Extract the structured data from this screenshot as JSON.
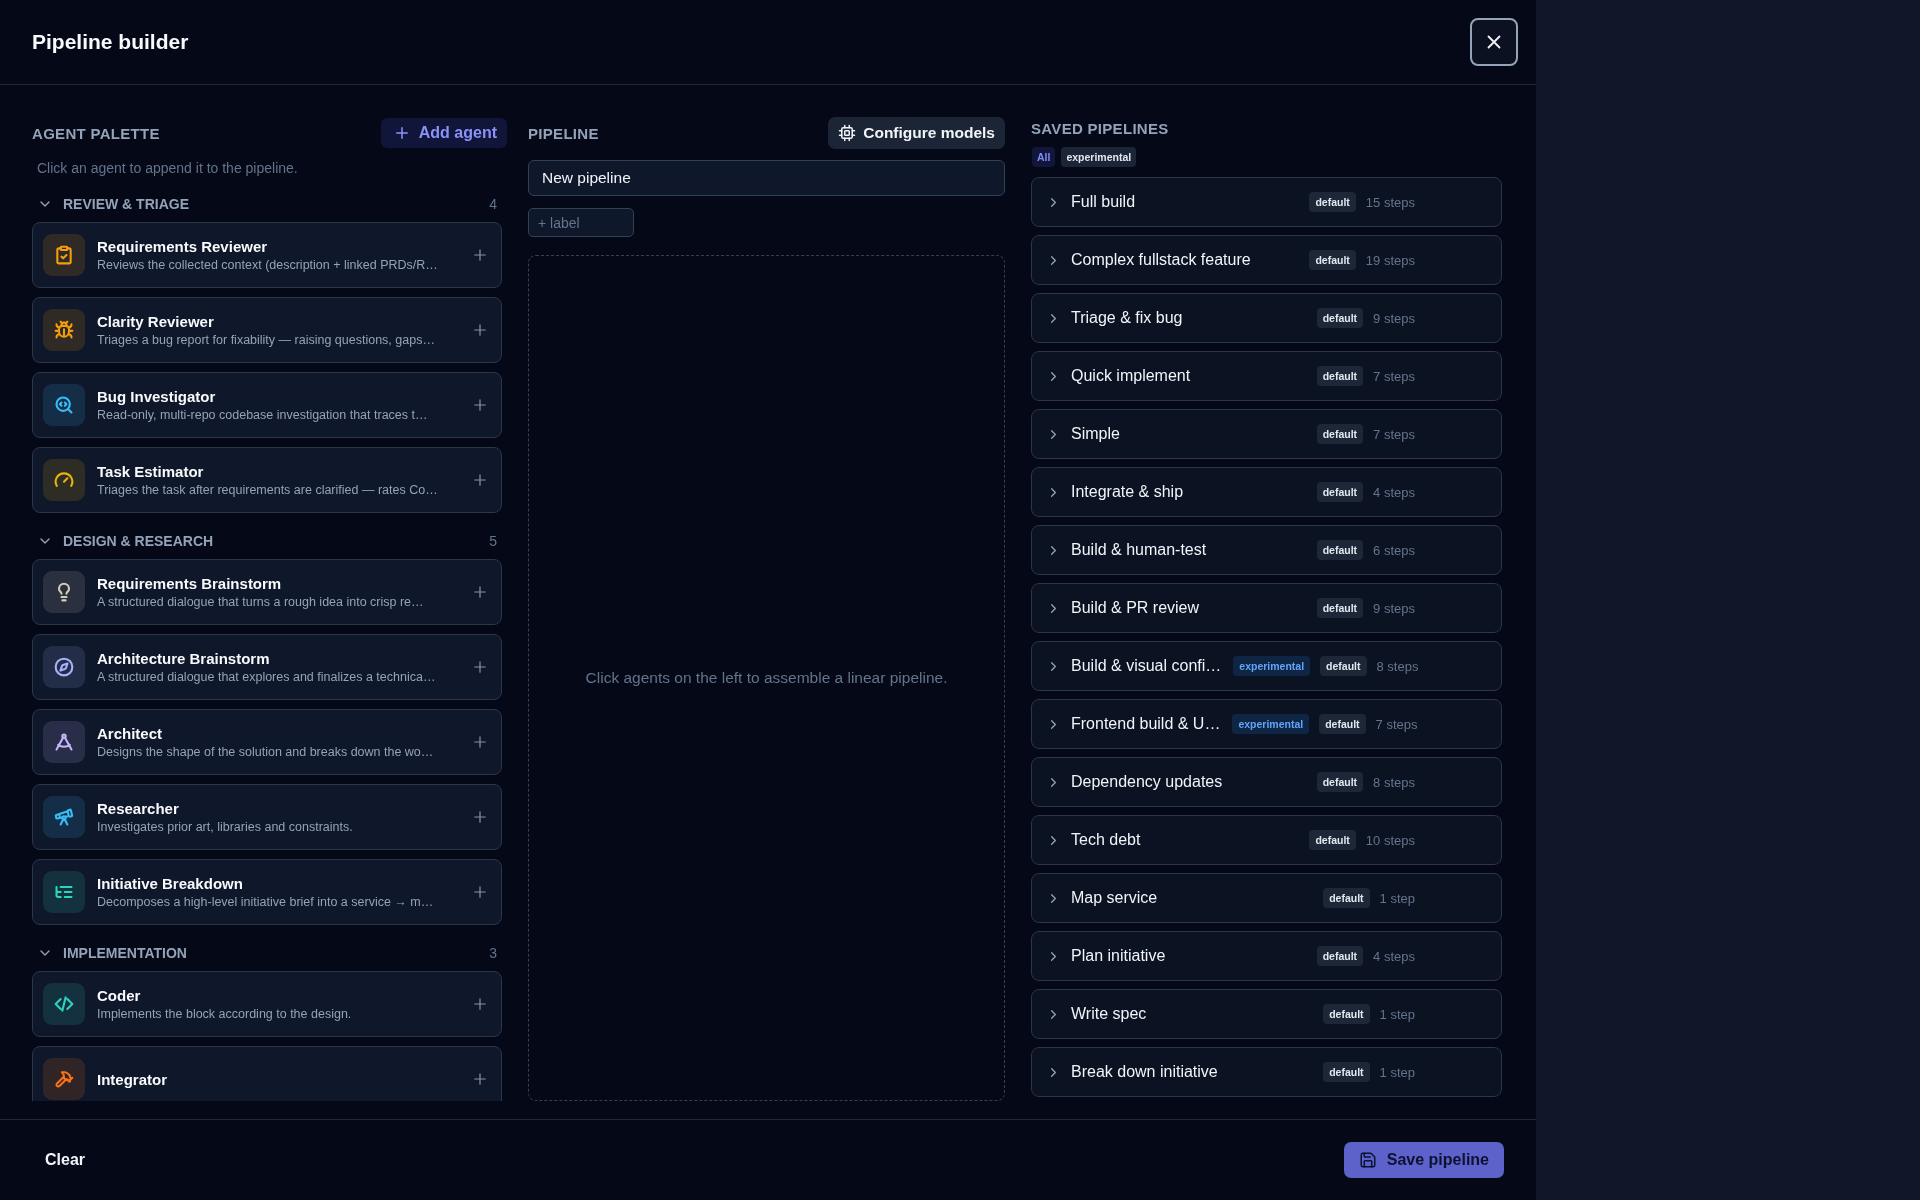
{
  "window": {
    "title": "Pipeline builder"
  },
  "palette": {
    "heading": "AGENT PALETTE",
    "add_button": "Add agent",
    "hint": "Click an agent to append it to the pipeline.",
    "groups": [
      {
        "name": "REVIEW & TRIAGE",
        "count": "4",
        "expanded": true,
        "agents": [
          {
            "name": "Requirements Reviewer",
            "description": "Reviews the collected context (description + linked PRDs/R…",
            "color": "#f59e0b"
          },
          {
            "name": "Clarity Reviewer",
            "description": "Triages a bug report for fixability — raising questions, gaps…",
            "color": "#f59e0b"
          },
          {
            "name": "Bug Investigator",
            "description": "Read-only, multi-repo codebase investigation that traces t…",
            "color": "#38bdf8"
          },
          {
            "name": "Task Estimator",
            "description": "Triages the task after requirements are clarified — rates Co…",
            "color": "#eab308"
          }
        ]
      },
      {
        "name": "DESIGN & RESEARCH",
        "count": "5",
        "expanded": true,
        "agents": [
          {
            "name": "Requirements Brainstorm",
            "description": "A structured dialogue that turns a rough idea into crisp re…",
            "color": "#d6cdb8"
          },
          {
            "name": "Architecture Brainstorm",
            "description": "A structured dialogue that explores and finalizes a technica…",
            "color": "#a5b4fc"
          },
          {
            "name": "Architect",
            "description": "Designs the shape of the solution and breaks down the wo…",
            "color": "#c4b5fd"
          },
          {
            "name": "Researcher",
            "description": "Investigates prior art, libraries and constraints.",
            "color": "#38bdf8"
          },
          {
            "name": "Initiative Breakdown",
            "description": "Decomposes a high-level initiative brief into a service → m…",
            "color": "#2dd4bf"
          }
        ]
      },
      {
        "name": "IMPLEMENTATION",
        "count": "3",
        "expanded": true,
        "agents": [
          {
            "name": "Coder",
            "description": "Implements the block according to the design.",
            "color": "#2dd4bf"
          },
          {
            "name": "Integrator",
            "color": "#f97316"
          }
        ]
      }
    ]
  },
  "pipeline": {
    "heading": "PIPELINE",
    "configure_button": "Configure models",
    "name_value": "New pipeline",
    "label_placeholder": "+ label",
    "empty_text": "Click agents on the left to assemble a linear pipeline."
  },
  "saved": {
    "heading": "SAVED PIPELINES",
    "filters": [
      {
        "label": "All",
        "selected": true
      },
      {
        "label": "experimental",
        "selected": false
      }
    ],
    "pipelines": [
      {
        "name": "Full build",
        "badge": "default",
        "steps": "15 steps",
        "expanded": false
      },
      {
        "name": "Complex fullstack feature",
        "badge": "default",
        "steps": "19 steps",
        "expanded": false
      },
      {
        "name": "Triage & fix bug",
        "badge": "default",
        "steps": "9 steps",
        "expanded": false
      },
      {
        "name": "Quick implement",
        "badge": "default",
        "steps": "7 steps",
        "expanded": false
      },
      {
        "name": "Simple",
        "badge": "default",
        "steps": "7 steps",
        "expanded": false
      },
      {
        "name": "Integrate & ship",
        "badge": "default",
        "steps": "4 steps",
        "expanded": false
      },
      {
        "name": "Build & human-test",
        "badge": "default",
        "steps": "6 steps",
        "expanded": false
      },
      {
        "name": "Build & PR review",
        "badge": "default",
        "steps": "9 steps",
        "expanded": false
      },
      {
        "name": "Build & visual confi…",
        "tags": [
          "experimental"
        ],
        "badge": "default",
        "steps": "8 steps",
        "expanded": false
      },
      {
        "name": "Frontend build & U…",
        "tags": [
          "experimental"
        ],
        "badge": "default",
        "steps": "7 steps",
        "expanded": false
      },
      {
        "name": "Dependency updates",
        "badge": "default",
        "steps": "8 steps",
        "expanded": false
      },
      {
        "name": "Tech debt",
        "badge": "default",
        "steps": "10 steps",
        "expanded": false
      },
      {
        "name": "Map service",
        "badge": "default",
        "steps": "1 step",
        "expanded": false
      },
      {
        "name": "Plan initiative",
        "badge": "default",
        "steps": "4 steps",
        "expanded": false
      },
      {
        "name": "Write spec",
        "badge": "default",
        "steps": "1 step",
        "expanded": false
      },
      {
        "name": "Break down initiative",
        "badge": "default",
        "steps": "1 step",
        "expanded": false
      }
    ]
  },
  "footer": {
    "clear_button": "Clear",
    "save_button": "Save pipeline"
  }
}
